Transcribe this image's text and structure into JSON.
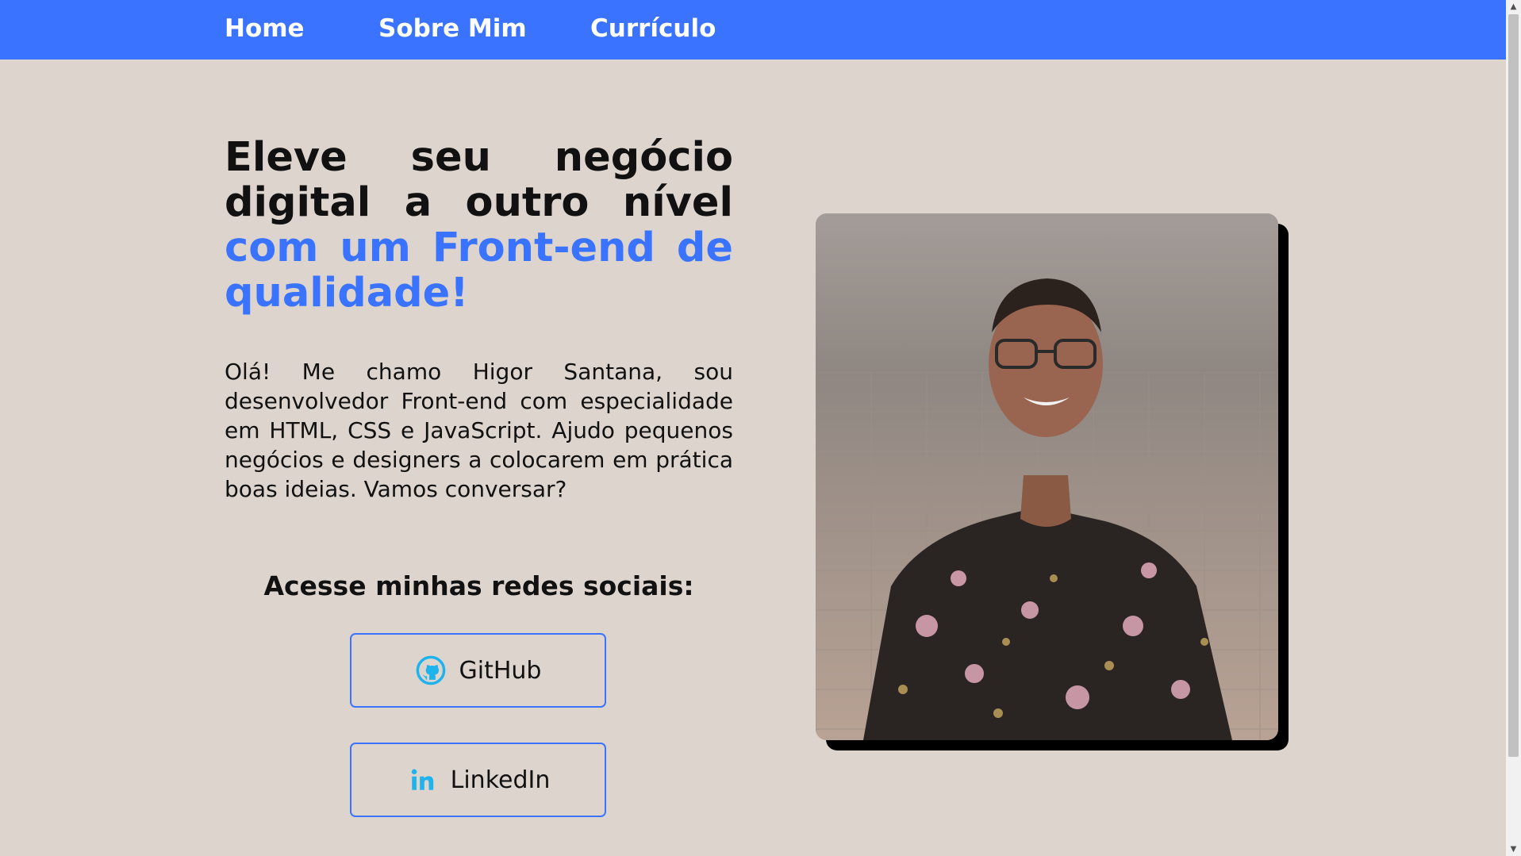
{
  "nav": {
    "home": "Home",
    "about": "Sobre Mim",
    "resume": "Currículo"
  },
  "hero": {
    "headline_dark": "Eleve seu negócio digital a outro nível",
    "headline_accent": "com um Front-end de qualidade!",
    "intro": "Olá! Me chamo Higor Santana, sou desenvolvedor Front-end com especialidade em HTML, CSS e JavaScript. Ajudo pequenos negócios e designers a colocarem em prática boas ideias. Vamos conversar?"
  },
  "social": {
    "heading": "Acesse minhas redes sociais:",
    "github_label": "GitHub",
    "linkedin_label": "LinkedIn"
  },
  "icons": {
    "github": "github-icon",
    "linkedin": "linkedin-icon"
  },
  "colors": {
    "accent": "#3a73ff",
    "background": "#ddd5cd",
    "icon": "#1fb3ee"
  }
}
